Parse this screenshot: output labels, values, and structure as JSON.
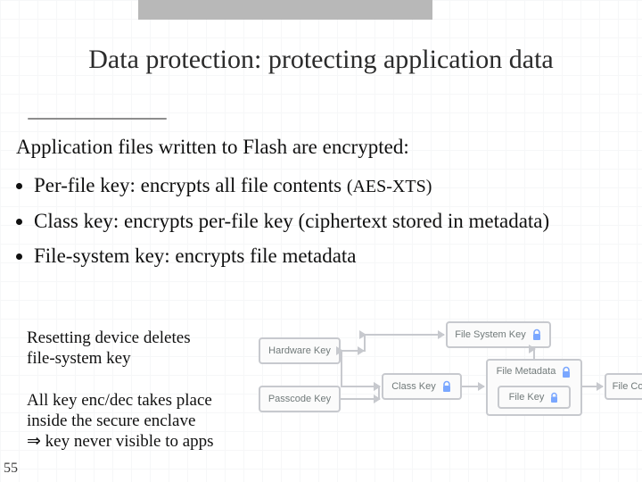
{
  "title": "Data protection:  protecting application data",
  "intro": "Application files written to Flash are encrypted:",
  "bullets": [
    {
      "kw": "Per-file key",
      "rest": ":   encrypts all file contents   ",
      "tail": "(AES-XTS)"
    },
    {
      "kw": "Class key",
      "rest": ":   encrypts  per-file key   (ciphertext stored in metadata)",
      "tail": ""
    },
    {
      "kw": "File-system key",
      "rest": ":   encrypts file metadata",
      "tail": ""
    }
  ],
  "note1_l1": "Resetting device deletes",
  "note1_l2": "file-system key",
  "note2_l1": "All key enc/dec takes place",
  "note2_l2": "inside the secure enclave",
  "note2_l3": "    ⇒   key never visible to apps",
  "pagenum": "55",
  "diagram": {
    "hardware": "Hardware Key",
    "passcode": "Passcode Key",
    "classkey": "Class Key",
    "fskey": "File System Key",
    "fmeta": "File Metadata",
    "fkey": "File Key",
    "fcontents": "File Contents"
  }
}
